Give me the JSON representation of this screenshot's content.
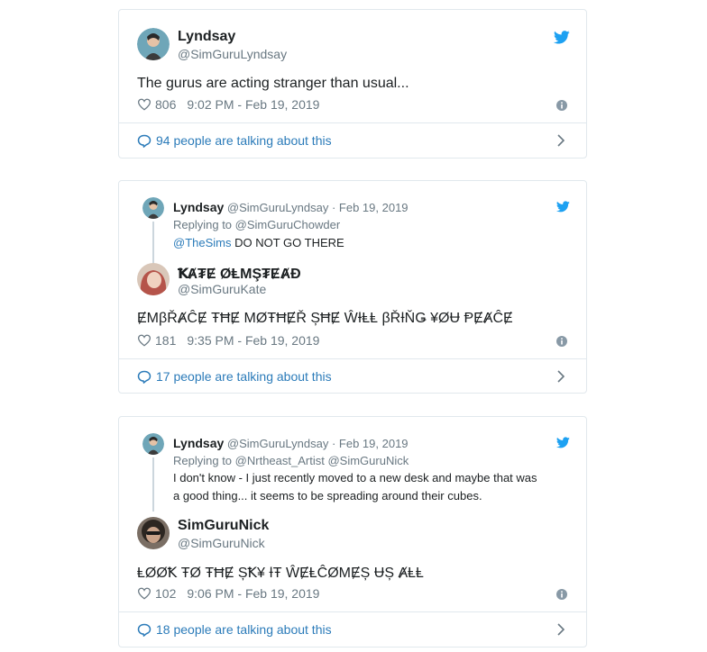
{
  "tweets": [
    {
      "author_name": "Lyndsay",
      "author_handle": "@SimGuruLyndsay",
      "text": "The gurus are acting stranger than usual...",
      "likes": "806",
      "timestamp": "9:02 PM - Feb 19, 2019",
      "talking": "94 people are talking about this"
    },
    {
      "quoted": {
        "name": "Lyndsay",
        "handle": "@SimGuruLyndsay",
        "date": "· Feb 19, 2019",
        "replying_prefix": "Replying to",
        "replying_to": "@SimGuruChowder",
        "mention": "@TheSims",
        "text": " DO NOT GO THERE"
      },
      "author_name": "ꝀȺ₮Ɇ ØⱠMŞ₮ɆȺĐ",
      "author_handle": "@SimGuruKate",
      "text": "ɆMβŘȺĈɆ ŦĦɆ MØŦĦɆŘ ȘĦɆ ŴƗⱠⱠ βŘƗŇǤ ¥ØɄ ⱣɆȺĈɆ",
      "likes": "181",
      "timestamp": "9:35 PM - Feb 19, 2019",
      "talking": "17 people are talking about this"
    },
    {
      "quoted": {
        "name": "Lyndsay",
        "handle": "@SimGuruLyndsay",
        "date": "· Feb 19, 2019",
        "replying_prefix": "Replying to",
        "replying_to": "@Nrtheast_Artist @SimGuruNick",
        "text_line1": "I don't know - I just recently moved to a new desk and maybe that was",
        "text_line2": "a good thing... it seems to be spreading around their cubes."
      },
      "author_name": "SimGuruNick",
      "author_handle": "@SimGuruNick",
      "text": "ⱠØØꝀ ŦØ ŦĦɆ ȘꝀ¥ ƗŦ ŴɆⱠĈØMɆȘ ɄȘ ȺⱠⱠ",
      "likes": "102",
      "timestamp": "9:06 PM - Feb 19, 2019",
      "talking": "18 people are talking about this"
    }
  ],
  "colors": {
    "twitter_blue": "#1da1f2",
    "link_blue": "#2b7bb9",
    "muted": "#697882",
    "border": "#e1e8ed"
  },
  "icons": [
    "twitter-bird-icon",
    "heart-icon",
    "info-icon",
    "speech-bubble-icon",
    "chevron-right-icon"
  ]
}
